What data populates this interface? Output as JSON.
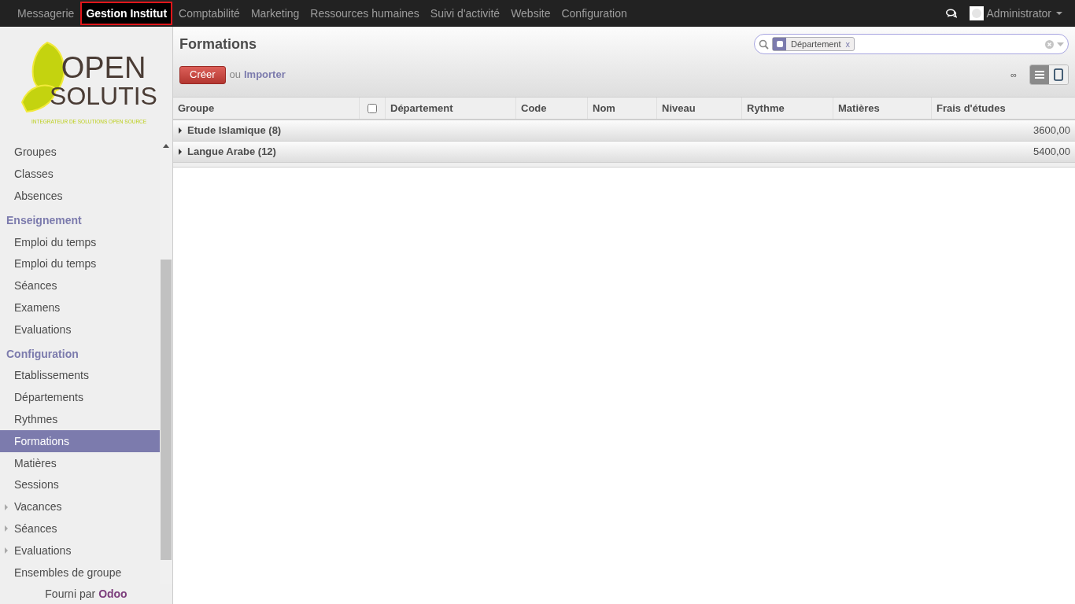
{
  "top_menu": [
    {
      "label": "Messagerie",
      "selected": false
    },
    {
      "label": "Gestion Institut",
      "selected": true
    },
    {
      "label": "Comptabilité",
      "selected": false
    },
    {
      "label": "Marketing",
      "selected": false
    },
    {
      "label": "Ressources humaines",
      "selected": false
    },
    {
      "label": "Suivi d'activité",
      "selected": false
    },
    {
      "label": "Website",
      "selected": false
    },
    {
      "label": "Configuration",
      "selected": false
    }
  ],
  "user": {
    "name": "Administrator"
  },
  "logo": {
    "line1": "OPEN",
    "line2": "SOLUTIS",
    "tagline": "INTEGRATEUR DE SOLUTIONS OPEN SOURCE"
  },
  "sidebar": {
    "items": [
      {
        "kind": "item",
        "label": "Groupes",
        "selected": false
      },
      {
        "kind": "item",
        "label": "Classes",
        "selected": false
      },
      {
        "kind": "item",
        "label": "Absences",
        "selected": false
      },
      {
        "kind": "section",
        "label": "Enseignement"
      },
      {
        "kind": "item",
        "label": "Emploi du temps",
        "selected": false
      },
      {
        "kind": "item",
        "label": "Emploi du temps",
        "selected": false
      },
      {
        "kind": "item",
        "label": "Séances",
        "selected": false
      },
      {
        "kind": "item",
        "label": "Examens",
        "selected": false
      },
      {
        "kind": "item",
        "label": "Evaluations",
        "selected": false
      },
      {
        "kind": "section",
        "label": "Configuration"
      },
      {
        "kind": "item",
        "label": "Etablissements",
        "selected": false
      },
      {
        "kind": "item",
        "label": "Départements",
        "selected": false
      },
      {
        "kind": "item",
        "label": "Rythmes",
        "selected": false
      },
      {
        "kind": "item",
        "label": "Formations",
        "selected": true
      },
      {
        "kind": "item",
        "label": "Matières",
        "selected": false
      },
      {
        "kind": "item",
        "label": "Sessions",
        "selected": false
      },
      {
        "kind": "folder",
        "label": "Vacances",
        "expanded": false
      },
      {
        "kind": "folder",
        "label": "Séances",
        "expanded": false
      },
      {
        "kind": "folder",
        "label": "Evaluations",
        "expanded": false
      },
      {
        "kind": "item",
        "label": "Ensembles de groupe",
        "selected": false
      }
    ],
    "footer_prefix": "Fourni par",
    "footer_link": "Odoo"
  },
  "page": {
    "title": "Formations",
    "create_button": "Créer",
    "or_text": "ou",
    "import_link": "Importer",
    "pager": "∞"
  },
  "search": {
    "facets": [
      {
        "label": "Département",
        "remove": "x"
      }
    ]
  },
  "views": [
    {
      "kind": "list",
      "selected": true
    },
    {
      "kind": "kanban",
      "selected": false
    }
  ],
  "table": {
    "columns": [
      {
        "kind": "text",
        "label": "Groupe"
      },
      {
        "kind": "checkbox",
        "checked": false
      },
      {
        "kind": "text",
        "label": "Département"
      },
      {
        "kind": "text",
        "label": "Code"
      },
      {
        "kind": "text",
        "label": "Nom"
      },
      {
        "kind": "text",
        "label": "Niveau"
      },
      {
        "kind": "text",
        "label": "Rythme"
      },
      {
        "kind": "text",
        "label": "Matières"
      },
      {
        "kind": "text",
        "label": "Frais d'études"
      }
    ],
    "groups": [
      {
        "label": "Etude Islamique (8)",
        "total": "3600,00",
        "expanded": false
      },
      {
        "label": "Langue Arabe (12)",
        "total": "5400,00",
        "expanded": false
      }
    ]
  }
}
